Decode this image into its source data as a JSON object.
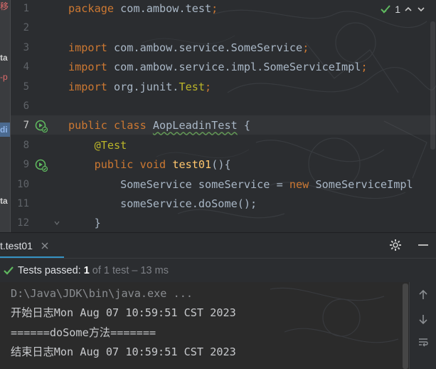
{
  "colors": {
    "keyword": "#cc7832",
    "annotation": "#bbb529",
    "method": "#ffc66d",
    "text": "#a9b7c6",
    "line_number": "#5f6368",
    "pass_green": "#5fb85f",
    "accent": "#3592c4"
  },
  "left_strip": {
    "fragments": [
      "移",
      "ta",
      "-p",
      "di",
      "ta"
    ]
  },
  "editor": {
    "inspection_count": "1",
    "current_line": 7,
    "lines": [
      {
        "num": "1",
        "has_run_icon": false,
        "parts": [
          {
            "t": "package ",
            "c": "kw"
          },
          {
            "t": "com.ambow.test",
            "c": ""
          },
          {
            "t": ";",
            "c": "kw"
          }
        ]
      },
      {
        "num": "2",
        "has_run_icon": false,
        "parts": []
      },
      {
        "num": "3",
        "has_run_icon": false,
        "parts": [
          {
            "t": "import ",
            "c": "kw"
          },
          {
            "t": "com.ambow.service.SomeService",
            "c": ""
          },
          {
            "t": ";",
            "c": "kw"
          }
        ]
      },
      {
        "num": "4",
        "has_run_icon": false,
        "parts": [
          {
            "t": "import ",
            "c": "kw"
          },
          {
            "t": "com.ambow.service.impl.SomeServiceImpl",
            "c": ""
          },
          {
            "t": ";",
            "c": "kw"
          }
        ]
      },
      {
        "num": "5",
        "has_run_icon": false,
        "parts": [
          {
            "t": "import ",
            "c": "kw"
          },
          {
            "t": "org.junit.",
            "c": ""
          },
          {
            "t": "Test",
            "c": "ann"
          },
          {
            "t": ";",
            "c": "kw"
          }
        ]
      },
      {
        "num": "6",
        "has_run_icon": false,
        "parts": []
      },
      {
        "num": "7",
        "has_run_icon": true,
        "parts": [
          {
            "t": "public class ",
            "c": "kw"
          },
          {
            "t": "AopLeadinTest",
            "c": "typo"
          },
          {
            "t": " {",
            "c": ""
          }
        ]
      },
      {
        "num": "8",
        "has_run_icon": false,
        "parts": [
          {
            "t": "    ",
            "c": ""
          },
          {
            "t": "@Test",
            "c": "ann"
          }
        ]
      },
      {
        "num": "9",
        "has_run_icon": true,
        "parts": [
          {
            "t": "    ",
            "c": ""
          },
          {
            "t": "public void ",
            "c": "kw"
          },
          {
            "t": "test01",
            "c": "fn"
          },
          {
            "t": "(){",
            "c": ""
          }
        ]
      },
      {
        "num": "10",
        "has_run_icon": false,
        "parts": [
          {
            "t": "        SomeService someService = ",
            "c": ""
          },
          {
            "t": "new ",
            "c": "kw"
          },
          {
            "t": "SomeServiceImpl",
            "c": ""
          }
        ]
      },
      {
        "num": "11",
        "has_run_icon": false,
        "parts": [
          {
            "t": "        someService.doSome();",
            "c": ""
          }
        ]
      },
      {
        "num": "12",
        "has_run_icon": false,
        "parts": [
          {
            "t": "    }",
            "c": ""
          }
        ]
      }
    ]
  },
  "run_tab": {
    "label": "t.test01"
  },
  "status": {
    "prefix": "Tests passed: ",
    "passed": "1",
    "rest": "of 1 test – 13 ms"
  },
  "console": {
    "lines": [
      "D:\\Java\\JDK\\bin\\java.exe ...",
      "开始日志Mon Aug 07 10:59:51 CST 2023",
      "======doSome方法=======",
      "结束日志Mon Aug 07 10:59:51 CST 2023"
    ]
  }
}
